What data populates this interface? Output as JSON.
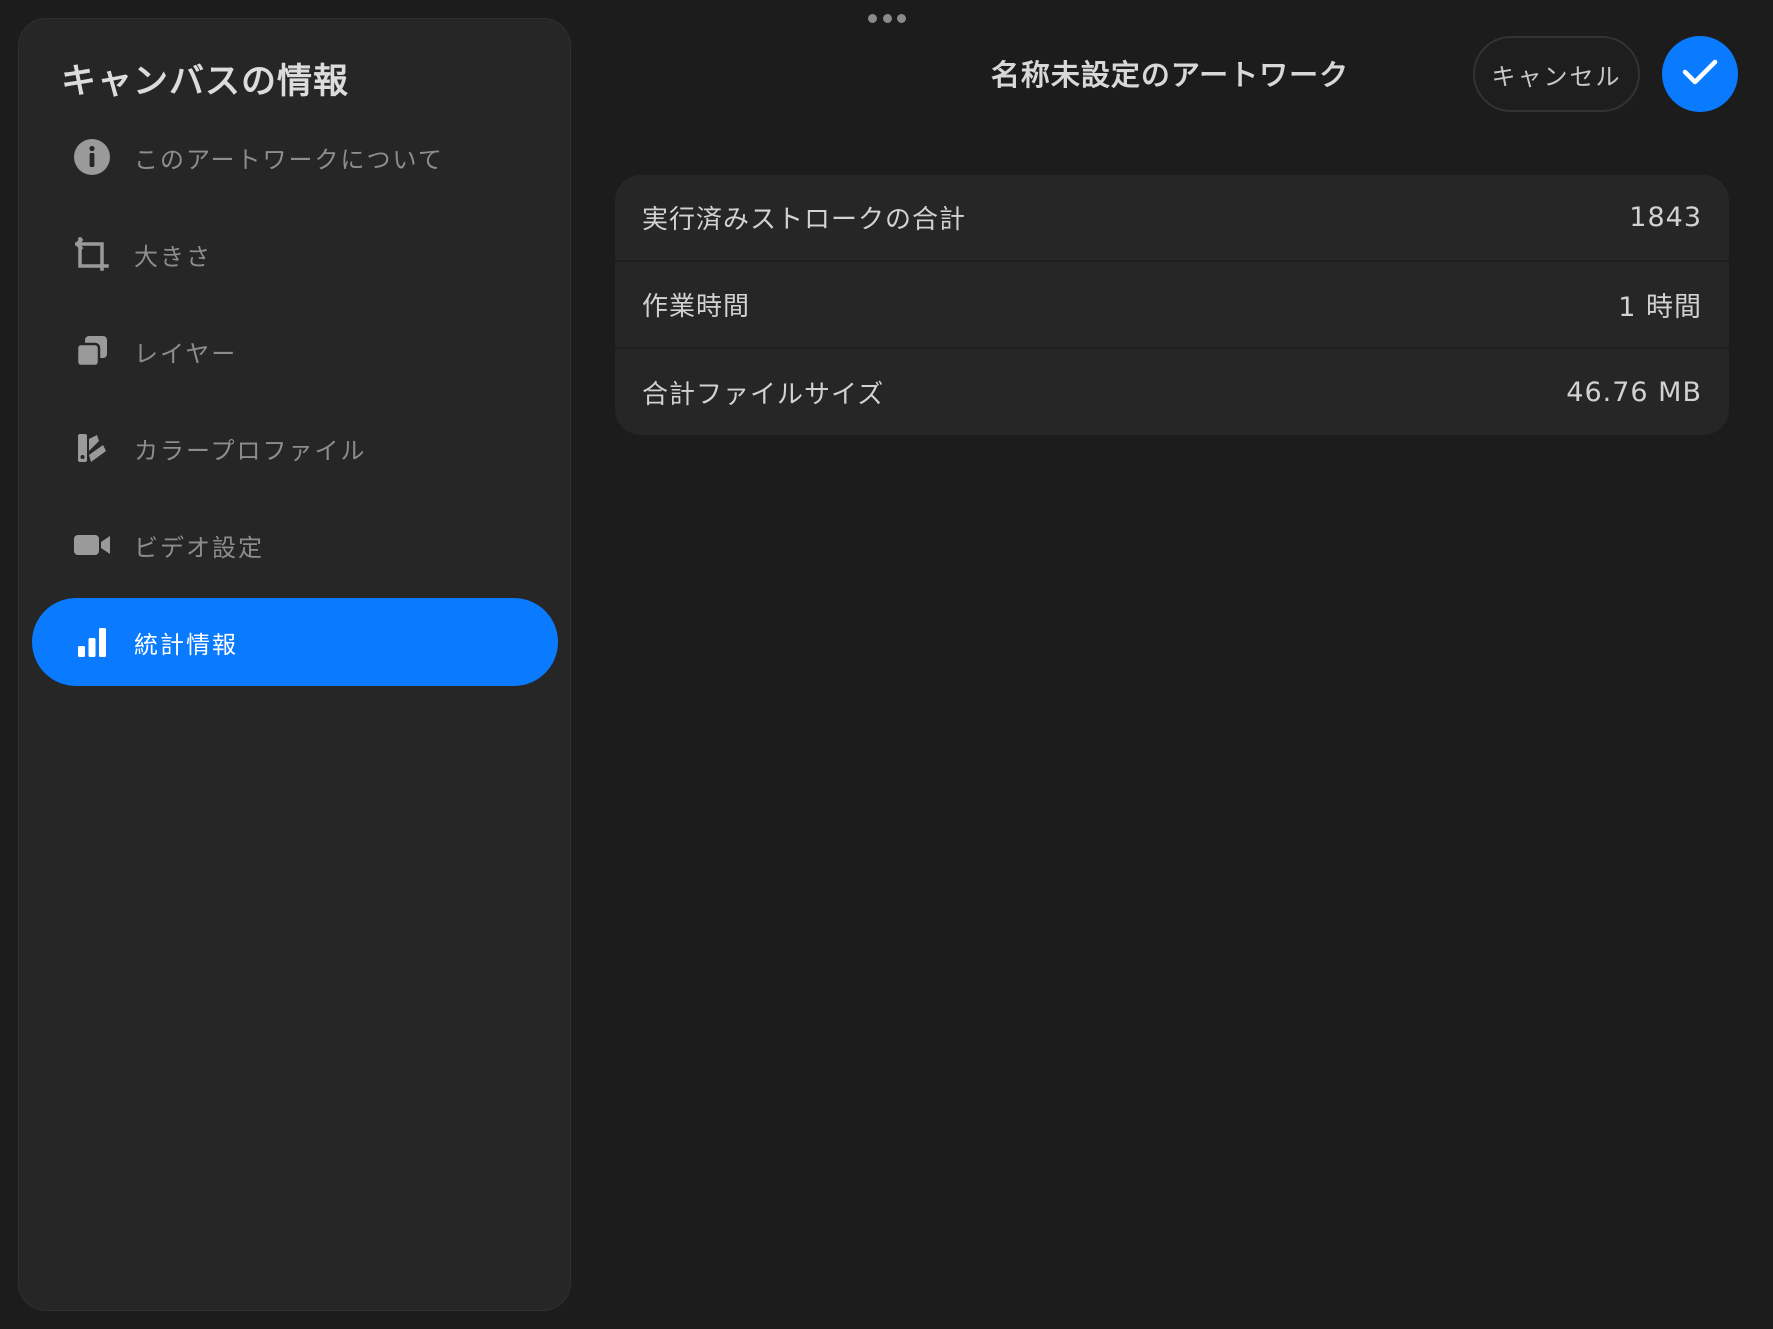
{
  "sidebar": {
    "title": "キャンバスの情報",
    "items": [
      {
        "label": "このアートワークについて",
        "icon": "info-icon",
        "active": false
      },
      {
        "label": "大きさ",
        "icon": "crop-icon",
        "active": false
      },
      {
        "label": "レイヤー",
        "icon": "layers-icon",
        "active": false
      },
      {
        "label": "カラープロファイル",
        "icon": "color-profile-icon",
        "active": false
      },
      {
        "label": "ビデオ設定",
        "icon": "video-camera-icon",
        "active": false
      },
      {
        "label": "統計情報",
        "icon": "bar-chart-icon",
        "active": true
      }
    ]
  },
  "header": {
    "title": "名称未設定のアートワーク",
    "cancel_label": "キャンセル"
  },
  "stats": {
    "rows": [
      {
        "label": "実行済みストロークの合計",
        "value": "1843"
      },
      {
        "label": "作業時間",
        "value": "1 時間"
      },
      {
        "label": "合計ファイルサイズ",
        "value": "46.76 MB"
      }
    ]
  },
  "colors": {
    "accent": "#0a7aff",
    "background": "#1c1c1c",
    "panel": "#262626",
    "inactive_text": "#8d8d8d"
  }
}
